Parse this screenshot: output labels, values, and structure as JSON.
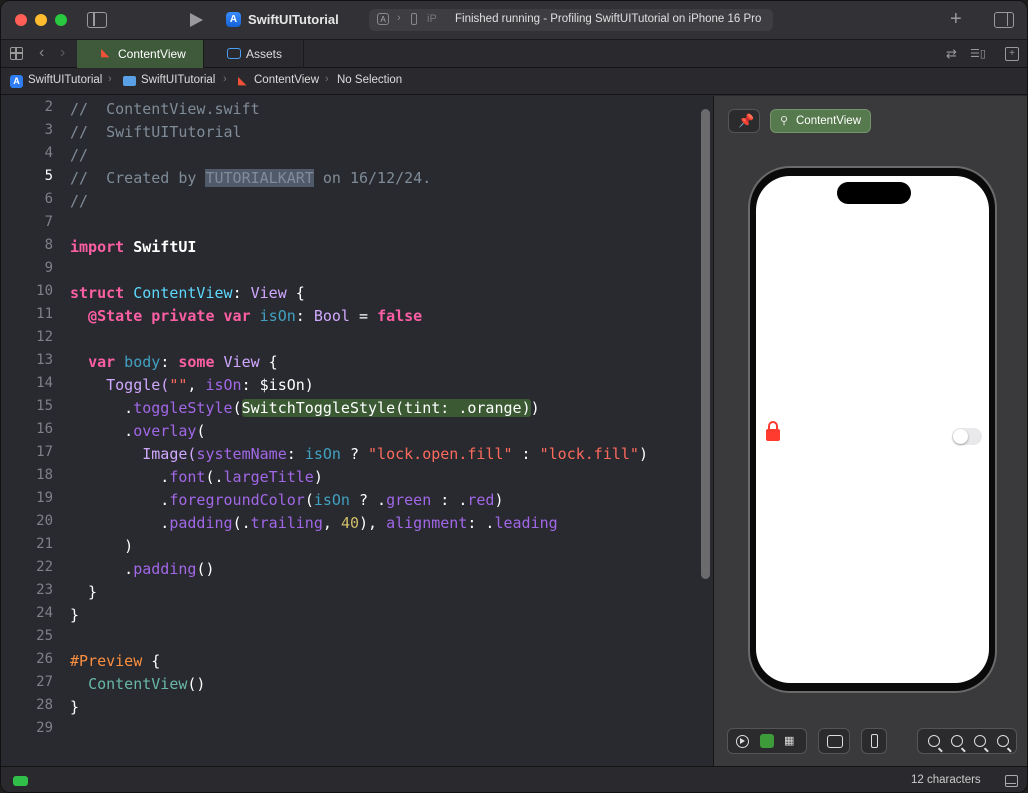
{
  "toolbar": {
    "app_title": "SwiftUITutorial",
    "status": "Finished running - Profiling SwiftUITutorial on iPhone 16 Pro",
    "destination_short": "iP",
    "colors": {
      "accent": "#2f7df2",
      "success": "#28c840"
    }
  },
  "tabs": [
    {
      "label": "ContentView",
      "icon": "swift-file-icon",
      "active": true
    },
    {
      "label": "Assets",
      "icon": "asset-catalog-icon",
      "active": false
    }
  ],
  "jumpbar": {
    "items": [
      "SwiftUITutorial",
      "SwiftUITutorial",
      "ContentView",
      "No Selection"
    ]
  },
  "editor": {
    "current_line": 5,
    "lines": [
      {
        "n": "2"
      },
      {
        "n": "3"
      },
      {
        "n": "4"
      },
      {
        "n": "5"
      },
      {
        "n": "6"
      },
      {
        "n": "7"
      },
      {
        "n": "8"
      },
      {
        "n": "9"
      },
      {
        "n": "10"
      },
      {
        "n": "11"
      },
      {
        "n": "12"
      },
      {
        "n": "13"
      },
      {
        "n": "14"
      },
      {
        "n": "15"
      },
      {
        "n": "16"
      },
      {
        "n": "17"
      },
      {
        "n": "18"
      },
      {
        "n": "19"
      },
      {
        "n": "20"
      },
      {
        "n": "21"
      },
      {
        "n": "22"
      },
      {
        "n": "23"
      },
      {
        "n": "24"
      },
      {
        "n": "25"
      },
      {
        "n": "26"
      },
      {
        "n": "27"
      },
      {
        "n": "28"
      },
      {
        "n": "29"
      }
    ],
    "code": {
      "l2": "//  ContentView.swift",
      "l3": "//  SwiftUITutorial",
      "l4": "//",
      "l5a": "//  Created by ",
      "l5sel": "TUTORIALKART",
      "l5b": " on 16/12/24.",
      "l6": "//",
      "l8kw": "import",
      "l8b": " SwiftUI",
      "l10kw": "struct",
      "l10name": " ContentView",
      "l10colon": ": ",
      "l10type": "View",
      "l10end": " {",
      "l11attr": "  @State",
      "l11kw": " private var",
      "l11var": " isOn",
      "l11colon": ": ",
      "l11type": "Bool",
      "l11eq": " = ",
      "l11val": "false",
      "l13indent": "  ",
      "l13kw": "var",
      "l13var": " body",
      "l13colon": ": ",
      "l13some": "some",
      "l13type": " View",
      "l13end": " {",
      "l14a": "    Toggle(",
      "l14str": "\"\"",
      "l14b": ", ",
      "l14lbl": "isOn",
      "l14c": ": $isOn)",
      "l15a": "      .",
      "l15fn": "toggleStyle",
      "l15p": "(",
      "l15hl": "SwitchToggleStyle(tint: .orange",
      "l15close": ")",
      "l15end": ")",
      "l16a": "      .",
      "l16fn": "overlay",
      "l16b": "(",
      "l17a": "        Image(",
      "l17lbl": "systemName",
      "l17b": ": ",
      "l17var": "isOn",
      "l17c": " ? ",
      "l17s1": "\"lock.open.fill\"",
      "l17d": " : ",
      "l17s2": "\"lock.fill\"",
      "l17e": ")",
      "l18a": "          .",
      "l18fn": "font",
      "l18b": "(.",
      "l18m": "largeTitle",
      "l18c": ")",
      "l19a": "          .",
      "l19fn": "foregroundColor",
      "l19b": "(",
      "l19var": "isOn",
      "l19c": " ? .",
      "l19m1": "green",
      "l19d": " : .",
      "l19m2": "red",
      "l19e": ")",
      "l20a": "          .",
      "l20fn": "padding",
      "l20b": "(.",
      "l20m": "trailing",
      "l20c": ", ",
      "l20num": "40",
      "l20d": "), ",
      "l20lbl": "alignment",
      "l20e": ": .",
      "l20m2": "leading",
      "l21": "      )",
      "l22a": "      .",
      "l22fn": "padding",
      "l22b": "()",
      "l23": "  }",
      "l24": "}",
      "l26kw": "#Preview",
      "l26b": " {",
      "l27a": "  ",
      "l27name": "ContentView",
      "l27b": "()",
      "l28": "}"
    }
  },
  "canvas": {
    "preview_label": "ContentView",
    "lock_symbol": "lock.fill",
    "lock_color": "#ff3b30",
    "toggle_on": false
  },
  "status": {
    "selection_info": "12 characters"
  }
}
